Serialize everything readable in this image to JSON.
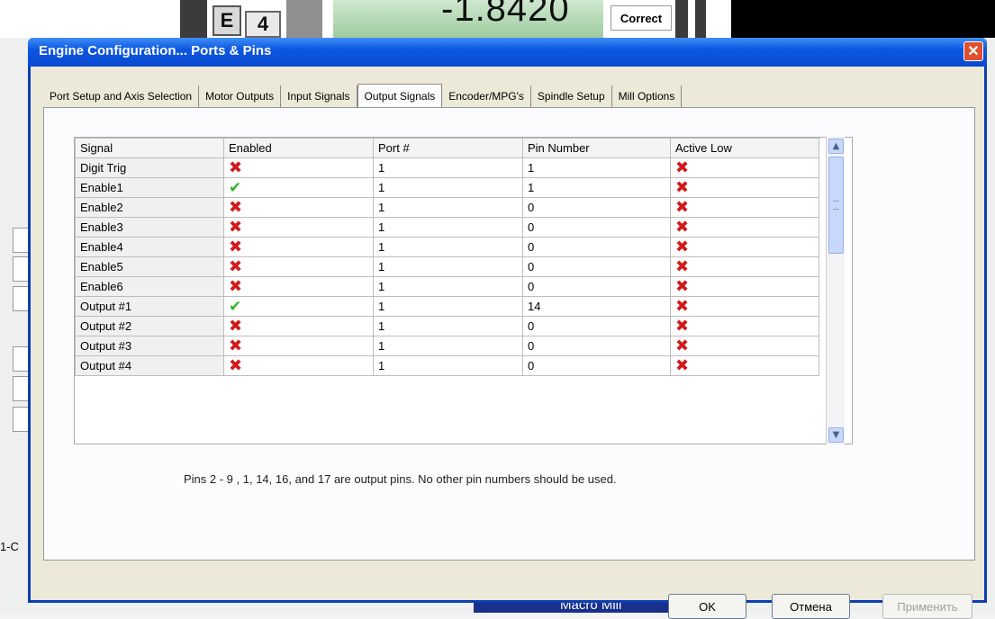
{
  "background": {
    "tile_e": "E",
    "tile_4": "4",
    "dro_value": "-1.8420",
    "correct_label": "Correct",
    "side_label": "1-C",
    "bottom_label": "Macro Mill"
  },
  "dialog": {
    "title": "Engine Configuration... Ports & Pins",
    "close_glyph": "✕",
    "tabs": [
      {
        "label": "Port Setup and Axis Selection"
      },
      {
        "label": "Motor Outputs"
      },
      {
        "label": "Input Signals"
      },
      {
        "label": "Output Signals",
        "active": true
      },
      {
        "label": "Encoder/MPG's"
      },
      {
        "label": "Spindle Setup"
      },
      {
        "label": "Mill Options"
      }
    ],
    "table": {
      "headers": [
        "Signal",
        "Enabled",
        "Port #",
        "Pin Number",
        "Active Low"
      ],
      "rows": [
        {
          "signal": "Digit Trig",
          "enabled": false,
          "port": "1",
          "pin": "1",
          "active_low": false
        },
        {
          "signal": "Enable1",
          "enabled": true,
          "port": "1",
          "pin": "1",
          "active_low": false
        },
        {
          "signal": "Enable2",
          "enabled": false,
          "port": "1",
          "pin": "0",
          "active_low": false
        },
        {
          "signal": "Enable3",
          "enabled": false,
          "port": "1",
          "pin": "0",
          "active_low": false
        },
        {
          "signal": "Enable4",
          "enabled": false,
          "port": "1",
          "pin": "0",
          "active_low": false
        },
        {
          "signal": "Enable5",
          "enabled": false,
          "port": "1",
          "pin": "0",
          "active_low": false
        },
        {
          "signal": "Enable6",
          "enabled": false,
          "port": "1",
          "pin": "0",
          "active_low": false
        },
        {
          "signal": "Output #1",
          "enabled": true,
          "port": "1",
          "pin": "14",
          "active_low": false
        },
        {
          "signal": "Output #2",
          "enabled": false,
          "port": "1",
          "pin": "0",
          "active_low": false
        },
        {
          "signal": "Output #3",
          "enabled": false,
          "port": "1",
          "pin": "0",
          "active_low": false
        },
        {
          "signal": "Output #4",
          "enabled": false,
          "port": "1",
          "pin": "0",
          "active_low": false
        }
      ],
      "check_glyph": "✔",
      "cross_glyph": "✖"
    },
    "scroll_up": "▲",
    "scroll_down": "▼",
    "note": "Pins 2 - 9 , 1, 14, 16, and 17 are output pins.  No  other pin numbers should be used.",
    "buttons": {
      "ok": "OK",
      "cancel": "Отмена",
      "apply": "Применить"
    }
  },
  "colors": {
    "title_bar": "#0d57e0",
    "cross": "#d11a1a",
    "check": "#33b72a"
  }
}
